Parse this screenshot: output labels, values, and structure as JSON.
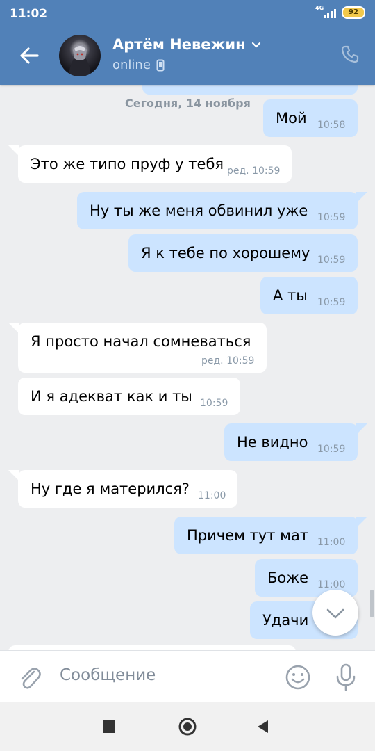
{
  "status_bar": {
    "time": "11:02",
    "network": "4G",
    "battery": "92"
  },
  "header": {
    "contact_name": "Артём Невежин",
    "status": "online"
  },
  "date_separator": "Сегодня, 14 ноября",
  "messages": [
    {
      "dir": "out",
      "text": "Мой",
      "meta": "10:58"
    },
    {
      "dir": "in",
      "text": "Это же типо пруф у тебя",
      "meta": "ред. 10:59"
    },
    {
      "dir": "out",
      "text": "Ну ты же меня обвинил уже",
      "meta": "10:59"
    },
    {
      "dir": "out",
      "text": "Я к тебе по хорошему",
      "meta": "10:59"
    },
    {
      "dir": "out",
      "text": "А ты",
      "meta": "10:59"
    },
    {
      "dir": "in",
      "text": "Я просто начал сомневаться",
      "meta": "ред. 10:59"
    },
    {
      "dir": "in",
      "text": "И я адекват как и ты",
      "meta": "10:59"
    },
    {
      "dir": "out",
      "text": "Не видно",
      "meta": "10:59"
    },
    {
      "dir": "in",
      "text": "Ну где я матерился?",
      "meta": "11:00"
    },
    {
      "dir": "out",
      "text": "Причем тут мат",
      "meta": "11:00"
    },
    {
      "dir": "out",
      "text": "Боже",
      "meta": "11:00"
    },
    {
      "dir": "out",
      "text": "Удачи",
      "meta": ""
    }
  ],
  "composer": {
    "placeholder": "Сообщение"
  },
  "icons": {
    "back": "arrow-left-icon",
    "dropdown": "chevron-down-icon",
    "device": "mobile-icon",
    "call": "phone-icon",
    "attach": "paperclip-icon",
    "emoji": "smile-icon",
    "voice": "microphone-icon",
    "scroll_down": "chevron-down-icon",
    "nav_recents": "square-icon",
    "nav_home": "circle-icon",
    "nav_back": "triangle-back-icon"
  },
  "colors": {
    "header": "#5181b8",
    "background": "#edeef0",
    "incoming": "#ffffff",
    "outgoing": "#cce4ff",
    "meta_text": "#8a99a8"
  }
}
